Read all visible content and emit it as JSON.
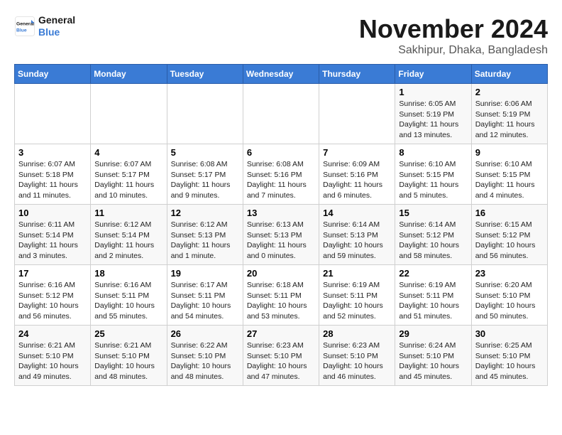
{
  "logo": {
    "line1": "General",
    "line2": "Blue"
  },
  "title": "November 2024",
  "location": "Sakhipur, Dhaka, Bangladesh",
  "days_of_week": [
    "Sunday",
    "Monday",
    "Tuesday",
    "Wednesday",
    "Thursday",
    "Friday",
    "Saturday"
  ],
  "weeks": [
    [
      {
        "day": "",
        "content": ""
      },
      {
        "day": "",
        "content": ""
      },
      {
        "day": "",
        "content": ""
      },
      {
        "day": "",
        "content": ""
      },
      {
        "day": "",
        "content": ""
      },
      {
        "day": "1",
        "content": "Sunrise: 6:05 AM\nSunset: 5:19 PM\nDaylight: 11 hours and 13 minutes."
      },
      {
        "day": "2",
        "content": "Sunrise: 6:06 AM\nSunset: 5:19 PM\nDaylight: 11 hours and 12 minutes."
      }
    ],
    [
      {
        "day": "3",
        "content": "Sunrise: 6:07 AM\nSunset: 5:18 PM\nDaylight: 11 hours and 11 minutes."
      },
      {
        "day": "4",
        "content": "Sunrise: 6:07 AM\nSunset: 5:17 PM\nDaylight: 11 hours and 10 minutes."
      },
      {
        "day": "5",
        "content": "Sunrise: 6:08 AM\nSunset: 5:17 PM\nDaylight: 11 hours and 9 minutes."
      },
      {
        "day": "6",
        "content": "Sunrise: 6:08 AM\nSunset: 5:16 PM\nDaylight: 11 hours and 7 minutes."
      },
      {
        "day": "7",
        "content": "Sunrise: 6:09 AM\nSunset: 5:16 PM\nDaylight: 11 hours and 6 minutes."
      },
      {
        "day": "8",
        "content": "Sunrise: 6:10 AM\nSunset: 5:15 PM\nDaylight: 11 hours and 5 minutes."
      },
      {
        "day": "9",
        "content": "Sunrise: 6:10 AM\nSunset: 5:15 PM\nDaylight: 11 hours and 4 minutes."
      }
    ],
    [
      {
        "day": "10",
        "content": "Sunrise: 6:11 AM\nSunset: 5:14 PM\nDaylight: 11 hours and 3 minutes."
      },
      {
        "day": "11",
        "content": "Sunrise: 6:12 AM\nSunset: 5:14 PM\nDaylight: 11 hours and 2 minutes."
      },
      {
        "day": "12",
        "content": "Sunrise: 6:12 AM\nSunset: 5:13 PM\nDaylight: 11 hours and 1 minute."
      },
      {
        "day": "13",
        "content": "Sunrise: 6:13 AM\nSunset: 5:13 PM\nDaylight: 11 hours and 0 minutes."
      },
      {
        "day": "14",
        "content": "Sunrise: 6:14 AM\nSunset: 5:13 PM\nDaylight: 10 hours and 59 minutes."
      },
      {
        "day": "15",
        "content": "Sunrise: 6:14 AM\nSunset: 5:12 PM\nDaylight: 10 hours and 58 minutes."
      },
      {
        "day": "16",
        "content": "Sunrise: 6:15 AM\nSunset: 5:12 PM\nDaylight: 10 hours and 56 minutes."
      }
    ],
    [
      {
        "day": "17",
        "content": "Sunrise: 6:16 AM\nSunset: 5:12 PM\nDaylight: 10 hours and 56 minutes."
      },
      {
        "day": "18",
        "content": "Sunrise: 6:16 AM\nSunset: 5:11 PM\nDaylight: 10 hours and 55 minutes."
      },
      {
        "day": "19",
        "content": "Sunrise: 6:17 AM\nSunset: 5:11 PM\nDaylight: 10 hours and 54 minutes."
      },
      {
        "day": "20",
        "content": "Sunrise: 6:18 AM\nSunset: 5:11 PM\nDaylight: 10 hours and 53 minutes."
      },
      {
        "day": "21",
        "content": "Sunrise: 6:19 AM\nSunset: 5:11 PM\nDaylight: 10 hours and 52 minutes."
      },
      {
        "day": "22",
        "content": "Sunrise: 6:19 AM\nSunset: 5:11 PM\nDaylight: 10 hours and 51 minutes."
      },
      {
        "day": "23",
        "content": "Sunrise: 6:20 AM\nSunset: 5:10 PM\nDaylight: 10 hours and 50 minutes."
      }
    ],
    [
      {
        "day": "24",
        "content": "Sunrise: 6:21 AM\nSunset: 5:10 PM\nDaylight: 10 hours and 49 minutes."
      },
      {
        "day": "25",
        "content": "Sunrise: 6:21 AM\nSunset: 5:10 PM\nDaylight: 10 hours and 48 minutes."
      },
      {
        "day": "26",
        "content": "Sunrise: 6:22 AM\nSunset: 5:10 PM\nDaylight: 10 hours and 48 minutes."
      },
      {
        "day": "27",
        "content": "Sunrise: 6:23 AM\nSunset: 5:10 PM\nDaylight: 10 hours and 47 minutes."
      },
      {
        "day": "28",
        "content": "Sunrise: 6:23 AM\nSunset: 5:10 PM\nDaylight: 10 hours and 46 minutes."
      },
      {
        "day": "29",
        "content": "Sunrise: 6:24 AM\nSunset: 5:10 PM\nDaylight: 10 hours and 45 minutes."
      },
      {
        "day": "30",
        "content": "Sunrise: 6:25 AM\nSunset: 5:10 PM\nDaylight: 10 hours and 45 minutes."
      }
    ]
  ]
}
